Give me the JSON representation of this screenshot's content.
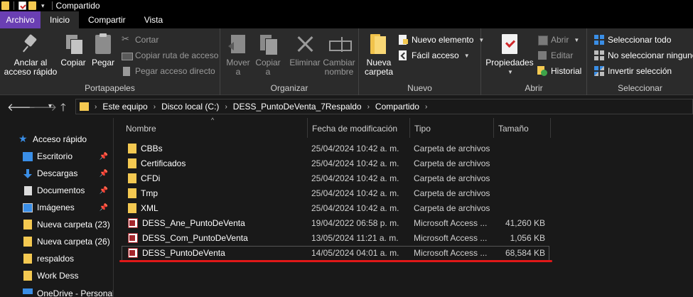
{
  "window": {
    "title": "Compartido"
  },
  "tabs": [
    {
      "label": "Archivo"
    },
    {
      "label": "Inicio"
    },
    {
      "label": "Compartir"
    },
    {
      "label": "Vista"
    }
  ],
  "ribbon": {
    "portapapeles": {
      "label": "Portapapeles",
      "pin": "Anclar al acceso rápido",
      "pin_line1": "Anclar al",
      "pin_line2": "acceso rápido",
      "copy": "Copiar",
      "paste": "Pegar",
      "cut": "Cortar",
      "copy_path": "Copiar ruta de acceso",
      "paste_shortcut": "Pegar acceso directo"
    },
    "organizar": {
      "label": "Organizar",
      "move": "Mover",
      "move_line1": "Mover",
      "move_line2": "a",
      "copy_to_line1": "Copiar",
      "copy_to_line2": "a",
      "delete": "Eliminar",
      "rename_line1": "Cambiar",
      "rename_line2": "nombre"
    },
    "nuevo": {
      "label": "Nuevo",
      "new_folder_line1": "Nueva",
      "new_folder_line2": "carpeta",
      "new_item": "Nuevo elemento",
      "easy_access": "Fácil acceso"
    },
    "abrir": {
      "label": "Abrir",
      "properties": "Propiedades",
      "open": "Abrir",
      "edit": "Editar",
      "history": "Historial"
    },
    "seleccionar": {
      "label": "Seleccionar",
      "select_all": "Seleccionar todo",
      "select_none": "No seleccionar ninguno",
      "invert": "Invertir selección"
    }
  },
  "address": {
    "crumbs": [
      "Este equipo",
      "Disco local (C:)",
      "DESS_PuntoDeVenta_7Respaldo",
      "Compartido"
    ]
  },
  "sidebar": {
    "items": [
      {
        "label": "Acceso rápido"
      },
      {
        "label": "Escritorio"
      },
      {
        "label": "Descargas"
      },
      {
        "label": "Documentos"
      },
      {
        "label": "Imágenes"
      },
      {
        "label": "Nueva carpeta (23)"
      },
      {
        "label": "Nueva carpeta (26)"
      },
      {
        "label": "respaldos"
      },
      {
        "label": "Work Dess"
      },
      {
        "label": "OneDrive - Personal"
      }
    ]
  },
  "filelist": {
    "columns": {
      "name": "Nombre",
      "date": "Fecha de modificación",
      "type": "Tipo",
      "size": "Tamaño"
    },
    "rows": [
      {
        "name": "CBBs",
        "date": "25/04/2024 10:42 a. m.",
        "type": "Carpeta de archivos",
        "size": ""
      },
      {
        "name": "Certificados",
        "date": "25/04/2024 10:42 a. m.",
        "type": "Carpeta de archivos",
        "size": ""
      },
      {
        "name": "CFDi",
        "date": "25/04/2024 10:42 a. m.",
        "type": "Carpeta de archivos",
        "size": ""
      },
      {
        "name": "Tmp",
        "date": "25/04/2024 10:42 a. m.",
        "type": "Carpeta de archivos",
        "size": ""
      },
      {
        "name": "XML",
        "date": "25/04/2024 10:42 a. m.",
        "type": "Carpeta de archivos",
        "size": ""
      },
      {
        "name": "DESS_Ane_PuntoDeVenta",
        "date": "19/04/2022 06:58 p. m.",
        "type": "Microsoft Access ...",
        "size": "41,260 KB"
      },
      {
        "name": "DESS_Com_PuntoDeVenta",
        "date": "13/05/2024 11:21 a. m.",
        "type": "Microsoft Access ...",
        "size": "1,056 KB"
      },
      {
        "name": "DESS_PuntoDeVenta",
        "date": "14/05/2024 04:01 a. m.",
        "type": "Microsoft Access ...",
        "size": "68,584 KB"
      }
    ]
  },
  "colors": {
    "file_tab": "#6a3fb3",
    "background": "#191919",
    "ribbon": "#2b2b2b",
    "folder": "#f4c951",
    "annotation_underline": "#e01818"
  }
}
